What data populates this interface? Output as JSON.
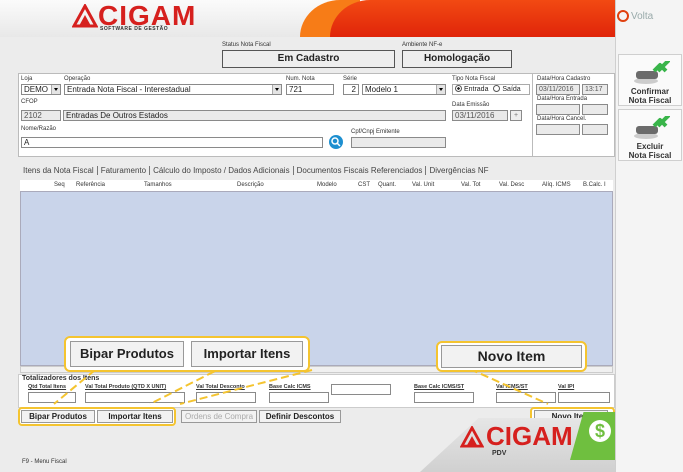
{
  "header": {
    "logo_text": "CIGAM",
    "logo_sub": "SOFTWARE DE GESTÃO"
  },
  "sidebar": {
    "back_label": "Volta",
    "confirm_label_1": "Confirmar",
    "confirm_label_2": "Nota Fiscal",
    "delete_label_1": "Excluir",
    "delete_label_2": "Nota Fiscal"
  },
  "status": {
    "nf_label": "Status Nota Fiscal",
    "nf_value": "Em Cadastro",
    "env_label": "Ambiente NF-e",
    "env_value": "Homologação"
  },
  "form": {
    "loja_label": "Loja",
    "loja_value": "DEMO",
    "operacao_label": "Operação",
    "operacao_value": "Entrada Nota Fiscal - Interestadual",
    "num_label": "Num. Nota",
    "num_value": "721",
    "serie_label": "Série",
    "serie_value": "2",
    "modelo_value": "Modelo 1",
    "tipo_label": "Tipo Nota Fiscal",
    "tipo_entrada": "Entrada",
    "tipo_saida": "Saída",
    "cfop_label": "CFOP",
    "cfop_code": "2102",
    "cfop_desc": "Entradas De Outros Estados",
    "emissao_label": "Data Emissão",
    "emissao_value": "03/11/2016",
    "nome_label": "Nome/Razão",
    "nome_value": "A",
    "cpf_label": "Cpf/Cnpj Emitente",
    "cpf_value": "",
    "dh_cadastro_label": "Data/Hora Cadastro",
    "dh_cadastro_date": "03/11/2016",
    "dh_cadastro_time": "13:17",
    "dh_entrada_label": "Data/Hora Entrada",
    "dh_cancel_label": "Data/Hora Cancel."
  },
  "tabs": [
    "Itens da Nota Fiscal",
    "Faturamento",
    "Cálculo do Imposto / Dados Adicionais",
    "Documentos Fiscais Referenciados",
    "Divergências NF"
  ],
  "grid": {
    "columns": [
      "Seq",
      "Referência",
      "Tamanhos",
      "Descrição",
      "Modelo",
      "CST",
      "Quant.",
      "Val. Unit",
      "Val. Tot",
      "Val. Desc",
      "Alíq. ICMS",
      "B.Calc. I"
    ]
  },
  "totals": {
    "title": "Totalizadores dos Itens",
    "qtd_label": "Qtd Total Itens",
    "vtp_label": "Val Total Produto (QTD X UNIT)",
    "vtd_label": "Val Total Desconto",
    "bci_label": "Base Calc ICMS",
    "bcist_label": "Base Calc ICMS/ST",
    "vist_label": "Val ICMS/ST",
    "vipi_label": "Val IPI"
  },
  "buttons": {
    "bipar": "Bipar Produtos",
    "importar": "Importar Itens",
    "ordens": "Ordens de Compra",
    "descontos": "Definir Descontos",
    "novo": "Novo Item"
  },
  "callouts": {
    "bipar": "Bipar Produtos",
    "importar": "Importar Itens",
    "novo": "Novo Item"
  },
  "footer": {
    "menu_hint": "F9 - Menu Fiscal",
    "logo_text": "CIGAM",
    "logo_sub": "PDV",
    "dollar": "$"
  },
  "colors": {
    "brand_red": "#d6201e",
    "header_red": "#e0250a",
    "highlight": "#f4c430",
    "grid_bg": "#c9d4ea",
    "green": "#6fbf3f"
  }
}
